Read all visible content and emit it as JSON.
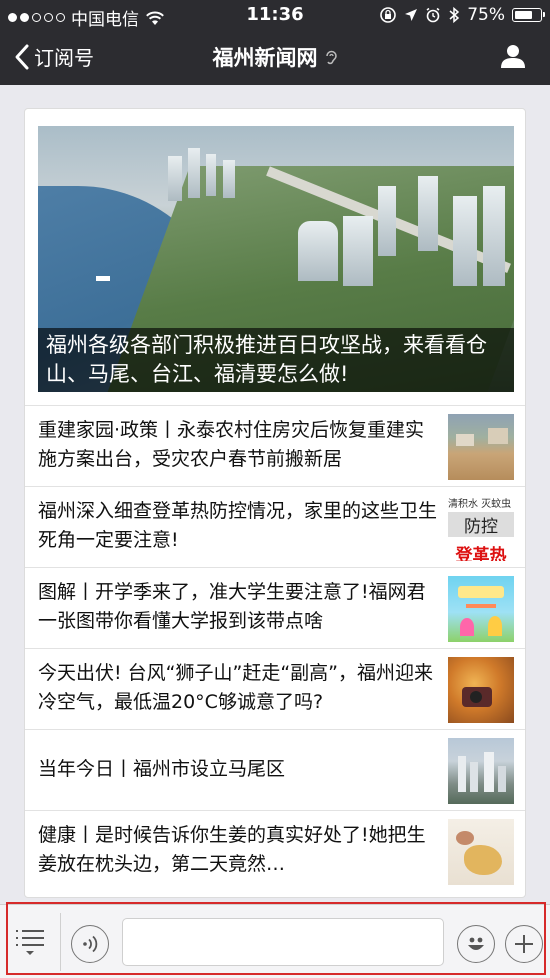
{
  "status_bar": {
    "carrier": "中国电信",
    "time": "11:36",
    "battery_text": "75%",
    "battery_level": 0.75
  },
  "nav": {
    "back_label": "订阅号",
    "title": "福州新闻网"
  },
  "hero": {
    "caption": "福州各级各部门积极推进百日攻坚战，来看看仓山、马尾、台江、福清要怎么做!"
  },
  "articles": [
    {
      "title": "重建家园·政策丨永泰农村住房灾后恢复重建实施方案出台，受灾农户春节前搬新居",
      "thumb": "construction-site"
    },
    {
      "title": "福州深入细查登革热防控情况，家里的这些卫生死角一定要注意!",
      "thumb": "dengue-poster",
      "thumb_text": {
        "line1": "清积水 灭蚊虫",
        "line2": "防控",
        "line3": "登革热"
      }
    },
    {
      "title": "图解丨开学季来了，准大学生要注意了!福网君一张图带你看懂大学报到该带点啥",
      "thumb": "cartoon-illustration"
    },
    {
      "title": "今天出伏! 台风“狮子山”赶走“副高”，福州迎来冷空气，最低温20°C够诚意了吗?",
      "thumb": "autumn-leaves-camera"
    },
    {
      "title": "当年今日丨福州市设立马尾区",
      "thumb": "city-skyline"
    },
    {
      "title": "健康丨是时候告诉你生姜的真实好处了!她把生姜放在枕头边，第二天竟然…",
      "thumb": "ginger"
    }
  ],
  "input_bar": {
    "placeholder": ""
  },
  "colors": {
    "nav_background": "#2c2c30",
    "highlight_outline": "#d62a2a",
    "page_background": "#e9e9ee"
  }
}
